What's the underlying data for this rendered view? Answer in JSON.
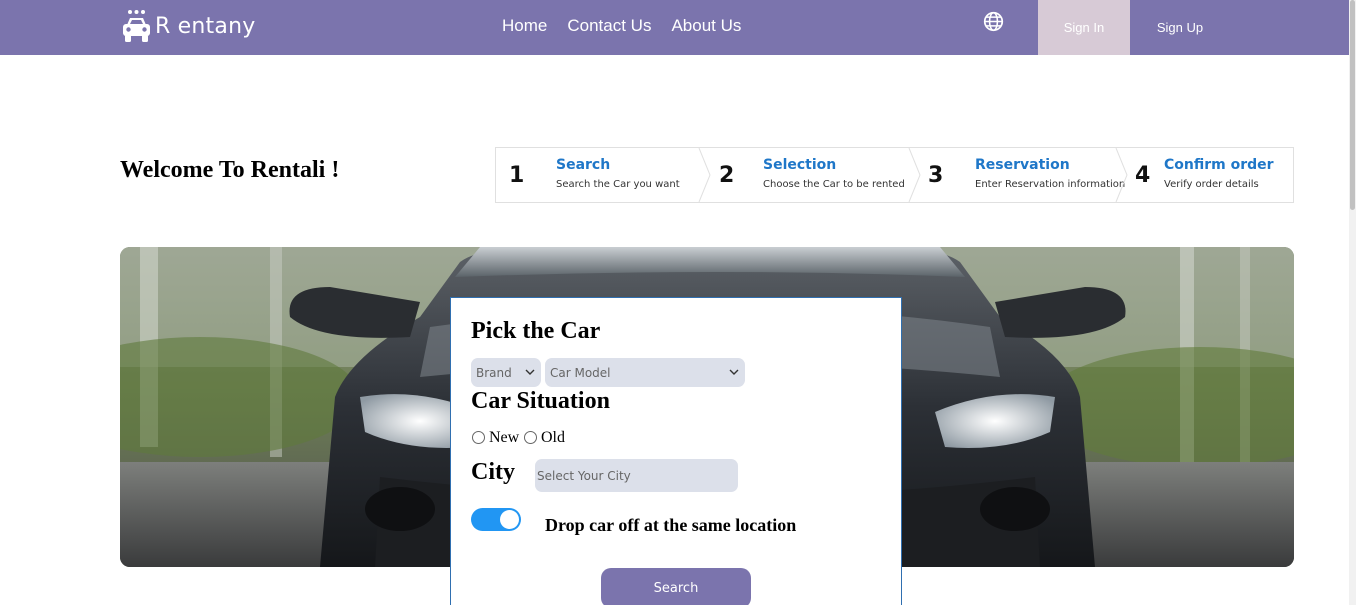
{
  "navbar": {
    "brand": "R entany",
    "links": [
      "Home",
      "Contact Us",
      "About Us"
    ],
    "language_icon": "globe-icon",
    "signin_label": "Sign In",
    "signup_label": "Sign Up",
    "colors": {
      "bar": "#7b74ad",
      "signin_bg": "#d7cad6"
    }
  },
  "welcome": "Welcome To Rentali !",
  "steps": [
    {
      "number": "1",
      "title": "Search",
      "desc": "Search the Car you want"
    },
    {
      "number": "2",
      "title": "Selection",
      "desc": "Choose the Car to be rented"
    },
    {
      "number": "3",
      "title": "Reservation",
      "desc": "Enter Reservation information"
    },
    {
      "number": "4",
      "title": "Confirm order",
      "desc": "Verify order details"
    }
  ],
  "form": {
    "pick_heading": "Pick the Car",
    "brand_select": "Brand",
    "model_select": "Car Model",
    "situation_heading": "Car Situation",
    "radio_new": "New",
    "radio_old": "Old",
    "city_heading": "City",
    "city_placeholder": "Select Your City",
    "same_location_toggle_on": true,
    "drop_label": "Drop car off at the same location",
    "search_label": "Search"
  },
  "hero_image": "car-front-photo"
}
